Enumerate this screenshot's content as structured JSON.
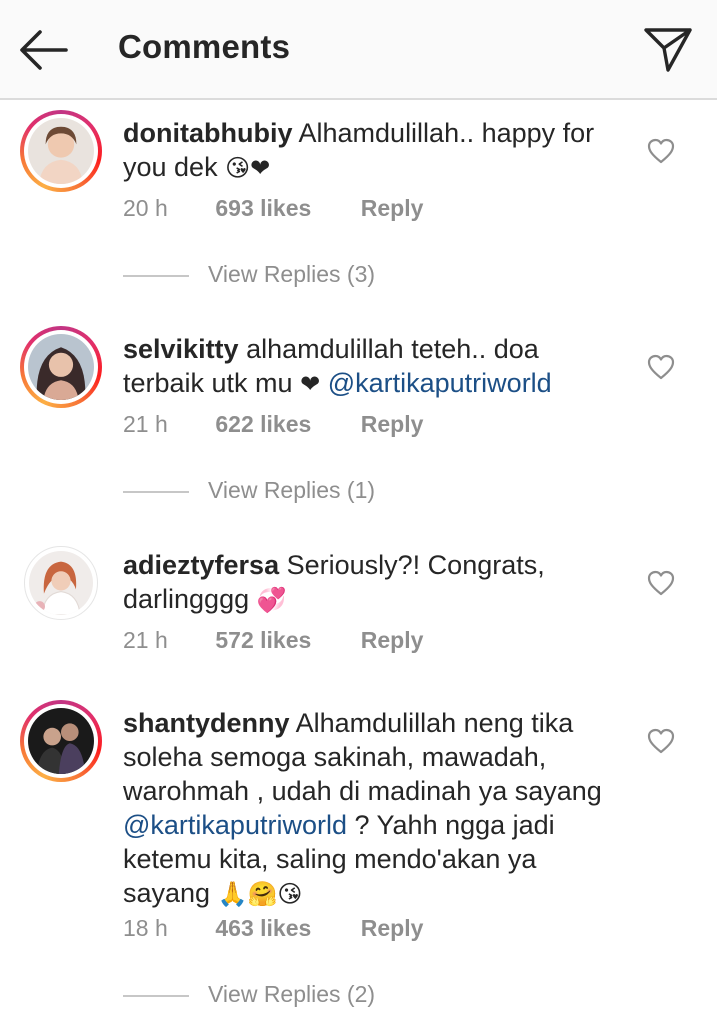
{
  "header": {
    "title": "Comments"
  },
  "comments": [
    {
      "username": "donitabhubiy",
      "text": "Alhamdulillah.. happy for you dek",
      "emoji": "😘❤",
      "time": "20 h",
      "likes": "693 likes",
      "reply": "Reply",
      "view_replies": "View Replies (3)"
    },
    {
      "username": "selvikitty",
      "text": "alhamdulillah teteh.. doa terbaik utk mu",
      "emoji": "❤",
      "mention": "@kartikaputriworld",
      "time": "21 h",
      "likes": "622 likes",
      "reply": "Reply",
      "view_replies": "View Replies (1)"
    },
    {
      "username": "adieztyfersa",
      "text": "Seriously?! Congrats, darlingggg",
      "emoji": "💞",
      "time": "21 h",
      "likes": "572 likes",
      "reply": "Reply"
    },
    {
      "username": "shantydenny",
      "text": "Alhamdulillah neng tika soleha semoga sakinah,  mawadah, warohmah , udah di madinah ya sayang",
      "mention": "@kartikaputriworld",
      "text2": "? Yahh ngga jadi ketemu kita, saling mendo'akan ya sayang",
      "emoji": "🙏🤗😘",
      "time": "18 h",
      "likes": "463 likes",
      "reply": "Reply",
      "view_replies": "View Replies (2)"
    }
  ]
}
